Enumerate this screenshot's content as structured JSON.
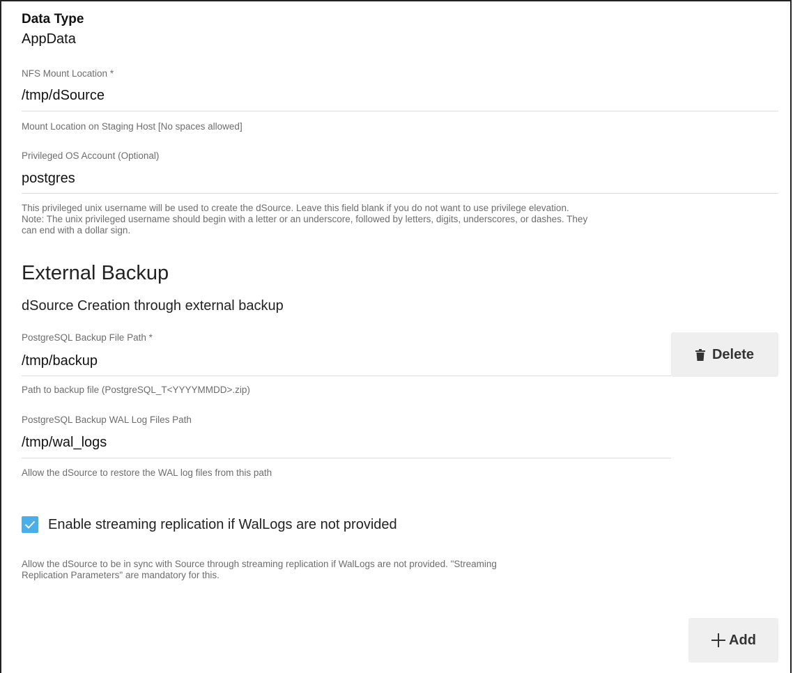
{
  "data_type": {
    "label": "Data Type",
    "value": "AppData"
  },
  "nfs_mount": {
    "label": "NFS Mount Location *",
    "value": "/tmp/dSource",
    "helper": "Mount Location on Staging Host [No spaces allowed]"
  },
  "privileged_account": {
    "label": "Privileged OS Account (Optional)",
    "value": "postgres",
    "helper_lines": [
      "This privileged unix username will be used to create the dSource. Leave this field blank if you do not want to use privilege elevation.",
      "Note: The unix privileged username should begin with a letter or an underscore, followed by letters, digits, underscores, or dashes. They",
      "can end with a dollar sign."
    ]
  },
  "external_backup": {
    "heading": "External Backup",
    "subheading": "dSource Creation through external backup",
    "backup_file": {
      "label": "PostgreSQL Backup File Path *",
      "value": "/tmp/backup",
      "helper": "Path to backup file (PostgreSQL_T<YYYYMMDD>.zip)"
    },
    "delete_button": {
      "label": "Delete",
      "icon": "trash-icon"
    },
    "wal_logs": {
      "label": "PostgreSQL Backup WAL Log Files Path",
      "value": "/tmp/wal_logs",
      "helper": "Allow the dSource to restore the WAL log files from this path"
    },
    "streaming": {
      "checked": true,
      "label": "Enable streaming replication if WalLogs are not provided",
      "helper_lines": [
        "Allow the dSource to be in sync with Source through streaming replication if WalLogs are not provided. \"Streaming",
        "Replication Parameters\" are mandatory for this."
      ]
    },
    "add_button": {
      "label": "Add",
      "icon": "plus-icon"
    }
  },
  "colors": {
    "checkbox": "#4aaee8",
    "button_bg": "#efefef"
  }
}
